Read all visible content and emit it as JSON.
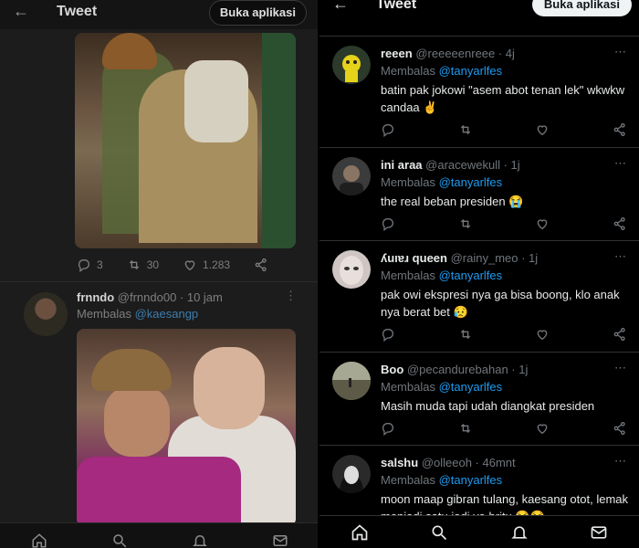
{
  "left": {
    "title": "Tweet",
    "open_app_label": "Buka aplikasi",
    "tweet1_actions": {
      "replies": "3",
      "retweets": "30",
      "likes": "1.283"
    },
    "tweet2": {
      "name": "frnndo",
      "meta": "@frnndo00 · 10 jam",
      "reply_prefix": "Membalas ",
      "reply_to": "@kaesangp"
    }
  },
  "right": {
    "title": "Tweet",
    "open_app_label": "Buka aplikasi",
    "replies": [
      {
        "name": "reeen",
        "meta": "@reeeeenreee · 4j",
        "reply_prefix": "Membalas ",
        "reply_to": "@tanyarlfes",
        "text": "batin pak jokowi \"asem abot tenan lek\" wkwkw candaa ✌️"
      },
      {
        "name": "ini araa",
        "meta": "@aracewekull · 1j",
        "reply_prefix": "Membalas ",
        "reply_to": "@tanyarlfes",
        "text": "the real beban presiden 😭"
      },
      {
        "name": "ʎuıɐɹ queen",
        "meta": "@rainy_meo · 1j",
        "reply_prefix": "Membalas ",
        "reply_to": "@tanyarlfes",
        "text": "pak owi ekspresi nya ga bisa boong, klo anak nya berat bet 😥"
      },
      {
        "name": "Boo",
        "meta": "@pecandurebahan · 1j",
        "reply_prefix": "Membalas ",
        "reply_to": "@tanyarlfes",
        "text": "Masih muda tapi udah diangkat presiden"
      },
      {
        "name": "salshu",
        "meta": "@olleeoh · 46mnt",
        "reply_prefix": "Membalas ",
        "reply_to": "@tanyarlfes",
        "text": "moon maap gibran tulang, kaesang otot, lemak menjadi satu jadi ya britu 😂😂"
      }
    ]
  },
  "colors": {
    "accent": "#1d9bf0",
    "muted": "#71767b",
    "text": "#e7e9ea"
  }
}
